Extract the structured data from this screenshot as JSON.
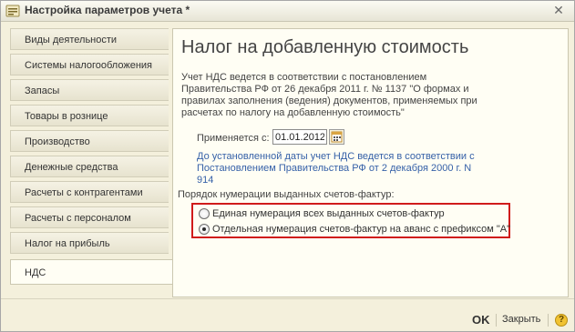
{
  "window": {
    "title": "Настройка параметров учета *",
    "close_symbol": "✕"
  },
  "tabs": [
    {
      "label": "Виды деятельности",
      "active": false
    },
    {
      "label": "Системы налогообложения",
      "active": false
    },
    {
      "label": "Запасы",
      "active": false
    },
    {
      "label": "Товары в рознице",
      "active": false
    },
    {
      "label": "Производство",
      "active": false
    },
    {
      "label": "Денежные средства",
      "active": false
    },
    {
      "label": "Расчеты с контрагентами",
      "active": false
    },
    {
      "label": "Расчеты с персоналом",
      "active": false
    },
    {
      "label": "Налог на прибыль",
      "active": false
    },
    {
      "label": "НДС",
      "active": true
    }
  ],
  "panel": {
    "heading": "Налог на добавленную стоимость",
    "description": "Учет НДС ведется в соответствии с постановлением Правительства РФ от 26 декабря 2011 г. № 1137 \"О формах и правилах заполнения (ведения) документов, применяемых при расчетах по налогу на добавленную стоимость\"",
    "applies_label": "Применяется с:",
    "applies_date": "01.01.2012",
    "link_note": "До установленной даты учет НДС ведется в соответствии с Постановлением Правительства РФ от 2 декабря 2000 г. N 914",
    "numbering_label": "Порядок нумерации выданных счетов-фактур:",
    "numbering_options": [
      {
        "label": "Единая нумерация всех выданных счетов-фактур",
        "checked": false
      },
      {
        "label": "Отдельная нумерация счетов-фактур на аванс с префиксом \"А\"",
        "checked": true
      }
    ]
  },
  "footer": {
    "ok_label": "OK",
    "close_label": "Закрыть",
    "help_label": "?"
  },
  "colors": {
    "highlight_border": "#d01b1b",
    "link": "#3661a8",
    "window_bg": "#f4f0dc",
    "panel_bg": "#fffef4"
  }
}
